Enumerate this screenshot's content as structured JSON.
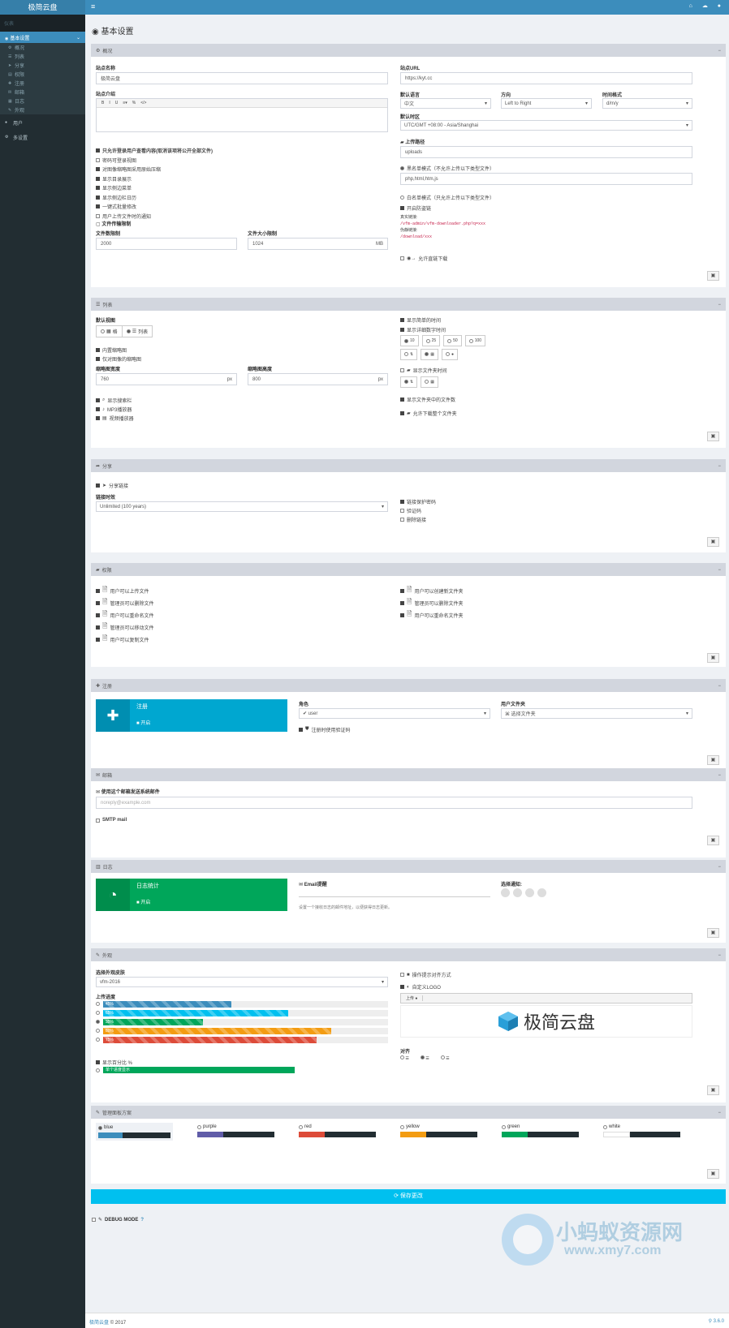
{
  "app": {
    "logo": "极简云盘",
    "menu_icon": "≡"
  },
  "topbar_icons": [
    "home-icon",
    "cloud-icon",
    "user-icon"
  ],
  "sidebar": {
    "header": "仪表",
    "section": "基本设置",
    "items": [
      {
        "label": "概况",
        "icon": "cogs-icon"
      },
      {
        "label": "列表",
        "icon": "list-icon"
      },
      {
        "label": "分享",
        "icon": "send-icon"
      },
      {
        "label": "权限",
        "icon": "folder-icon"
      },
      {
        "label": "注册",
        "icon": "user-plus-icon"
      },
      {
        "label": "邮箱",
        "icon": "envelope-icon"
      },
      {
        "label": "日志",
        "icon": "chart-icon"
      },
      {
        "label": "外观",
        "icon": "brush-icon"
      }
    ],
    "users": "用户",
    "more": "多设置"
  },
  "page": {
    "title": "基本设置"
  },
  "general": {
    "header": "概况",
    "site_name_label": "站点名称",
    "site_name": "极简云盘",
    "site_desc_label": "站点介绍",
    "editor_buttons": [
      "B",
      "I",
      "U",
      "≡▾",
      "%",
      "</>"
    ],
    "checks": [
      {
        "label": "只允许登录用户查看内容(取消该项将公开全部文件)",
        "on": true,
        "bold": true
      },
      {
        "label": "密码可登录视图",
        "on": false
      },
      {
        "label": "对图像缩略图采用原始压缩",
        "on": true
      },
      {
        "label": "显示目录展示",
        "on": true
      },
      {
        "label": "显示侧边菜单",
        "on": true
      },
      {
        "label": "显示侧边栏日历",
        "on": true
      },
      {
        "label": "一键式批量修改",
        "on": true
      },
      {
        "label": "用户上传文件时的通知",
        "on": false
      }
    ],
    "upload_limit_title": "文件传输限制",
    "file_count_label": "文件数限制",
    "file_count": "2000",
    "file_size_label": "文件大小限制",
    "file_size": "1024",
    "file_size_unit": "MB",
    "site_url_label": "站点URL",
    "site_url": "https://kyt.cc",
    "lang_label": "默认语言",
    "lang": "中文",
    "dir_label": "方向",
    "dir": "Left to Right",
    "time_label": "时间格式",
    "time": "d/m/y",
    "tz_label": "默认时区",
    "tz": "UTC/GMT +08:00 - Asia/Shanghai",
    "upload_dir_label": "上传路径",
    "upload_dir": "uploads",
    "blacklist_label": "黑名单模式（不允许上传以下类型文件）",
    "blacklist": "php,html,htm,js",
    "whitelist_label": "白名单模式（只允许上传以下类型文件）",
    "direct_label": "开启防盗链",
    "direct_note1": "真实链接:",
    "direct_code1": "/vfm-admin/vfm-downloader.php?q=xxx",
    "direct_note2": "伪静链接:",
    "direct_code2": "/download/xxx",
    "direct_dl_label": "允许直链下载"
  },
  "list": {
    "header": "列表",
    "view_label": "默认视图",
    "view_grid": "格",
    "view_list": "列表",
    "checks_left": [
      {
        "label": "内置缩略图",
        "on": true
      },
      {
        "label": "仅对图像的缩略图",
        "on": true
      }
    ],
    "thumb_w_label": "缩略图宽度",
    "thumb_w": "760",
    "thumb_w_unit": "px",
    "thumb_h_label": "缩略图高度",
    "thumb_h": "800",
    "thumb_h_unit": "px",
    "checks_left2": [
      {
        "label": "显示搜索栏",
        "on": true
      },
      {
        "label": "MP3播放器",
        "on": true
      },
      {
        "label": "视频播放器",
        "on": true
      }
    ],
    "right_checks": [
      {
        "label": "显示简单的时间",
        "on": true
      },
      {
        "label": "显示详细数字时间",
        "on": true
      }
    ],
    "per_page": [
      "10",
      "25",
      "50",
      "100"
    ],
    "show_folders_label": "显示文件夹时间",
    "count_label": "显示文件夹中的文件数",
    "dl_folder_label": "允许下载整个文件夹"
  },
  "share": {
    "header": "分享",
    "share_label": "分享链接",
    "expire_label": "链接时效",
    "expire": "Unlimited (100 years)",
    "right": [
      {
        "label": "链接保护密码",
        "on": true
      },
      {
        "label": "验证码",
        "on": false
      },
      {
        "label": "删除链接",
        "on": false
      }
    ]
  },
  "perms": {
    "header": "权限",
    "left": [
      "用户可以上传文件",
      "管理员可以删除文件",
      "用户可以重命名文件",
      "管理员可以移动文件",
      "用户可以复制文件"
    ],
    "right": [
      "用户可以创建新文件夹",
      "管理员可以删除文件夹",
      "用户可以重命名文件夹"
    ]
  },
  "register": {
    "header": "注册",
    "box_title": "注册",
    "box_sub": "开启",
    "role_label": "角色",
    "role": "user",
    "folder_label": "用户文件夹",
    "folder": "选择文件夹",
    "captcha_label": "注册时使用验证码"
  },
  "email": {
    "header": "邮箱",
    "from_label": "使用这个邮箱发送系统邮件",
    "from_placeholder": "noreply@example.com",
    "smtp_label": "SMTP mail"
  },
  "log": {
    "header": "日志",
    "box_title": "日志统计",
    "box_sub": "开启",
    "email_label": "Email提醒",
    "email_note": "设置一个接收日志的邮件地址，以便获得日志更新。",
    "select_label": "选择通知:"
  },
  "appearance": {
    "header": "外观",
    "skin_label": "选择外观皮肤",
    "skin": "vfm-2016",
    "progress_label": "上传进度",
    "bars": [
      {
        "label": "蓝色",
        "pct": 45,
        "color": "#3c8dbc"
      },
      {
        "label": "青色",
        "pct": 65,
        "color": "#00c0ef"
      },
      {
        "label": "绿色",
        "pct": 35,
        "color": "#00a65a"
      },
      {
        "label": "黄色",
        "pct": 80,
        "color": "#f39c12"
      },
      {
        "label": "红色",
        "pct": 75,
        "color": "#dd4b39"
      }
    ],
    "pct_label": "显示百分比 %",
    "single_label": "单个进度显示",
    "right_checks": [
      {
        "label": "操作提示对齐方式",
        "on": false
      },
      {
        "label": "自定义LOGO",
        "on": true
      }
    ],
    "upload_btn": "上传",
    "logo_text": "极简云盘",
    "align_label": "对齐"
  },
  "theme": {
    "header": "管理面板方案",
    "swatches": [
      {
        "name": "blue",
        "c1": "#3c8dbc",
        "c2": "#222d32"
      },
      {
        "name": "purple",
        "c1": "#605ca8",
        "c2": "#222d32"
      },
      {
        "name": "red",
        "c1": "#dd4b39",
        "c2": "#222d32"
      },
      {
        "name": "yellow",
        "c1": "#f39c12",
        "c2": "#222d32"
      },
      {
        "name": "green",
        "c1": "#00a65a",
        "c2": "#222d32"
      },
      {
        "name": "white",
        "c1": "#ffffff",
        "c2": "#222d32"
      }
    ]
  },
  "submit": "保存更改",
  "debug": "DEBUG MODE",
  "footer": {
    "brand": "极简云盘",
    "year": "© 2017",
    "version": "3.6.0"
  },
  "watermark": {
    "line1": "小蚂蚁资源网",
    "line2": "www.xmy7.com"
  }
}
